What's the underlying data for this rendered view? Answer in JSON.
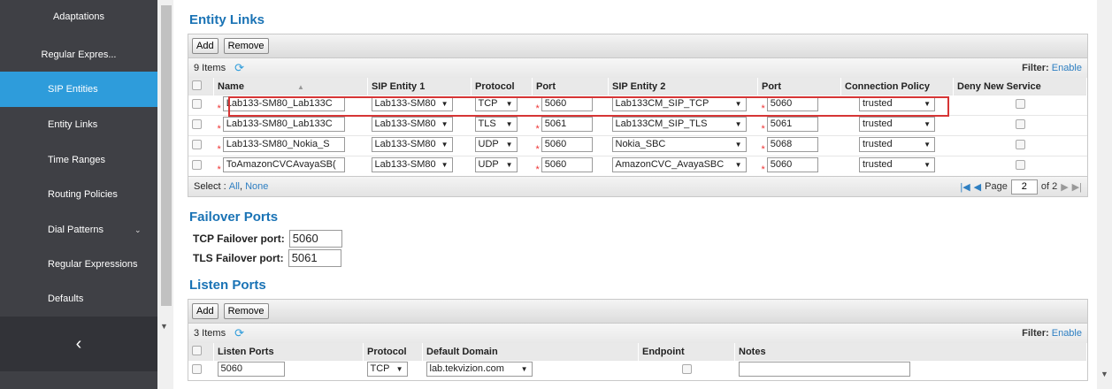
{
  "sidebar": {
    "items": [
      {
        "label": "Adaptations"
      },
      {
        "label": "Regular Expres..."
      },
      {
        "label": "SIP Entities"
      },
      {
        "label": "Entity Links"
      },
      {
        "label": "Time Ranges"
      },
      {
        "label": "Routing Policies"
      },
      {
        "label": "Dial Patterns"
      },
      {
        "label": "Regular Expressions"
      },
      {
        "label": "Defaults"
      }
    ],
    "collapse_icon": "chevron-left-icon",
    "collapse_glyph": "‹"
  },
  "entity_links": {
    "title": "Entity Links",
    "add_label": "Add",
    "remove_label": "Remove",
    "count_label": "9 Items",
    "filter_label": "Filter:",
    "filter_link": "Enable",
    "columns": [
      "Name",
      "SIP Entity 1",
      "Protocol",
      "Port",
      "SIP Entity 2",
      "Port",
      "Connection Policy",
      "Deny New Service"
    ],
    "rows": [
      {
        "name": "Lab133-SM80_Lab133C",
        "entity1": "Lab133-SM80",
        "protocol": "TCP",
        "port1": "5060",
        "entity2": "Lab133CM_SIP_TCP",
        "port2": "5060",
        "policy": "trusted"
      },
      {
        "name": "Lab133-SM80_Lab133C",
        "entity1": "Lab133-SM80",
        "protocol": "TLS",
        "port1": "5061",
        "entity2": "Lab133CM_SIP_TLS",
        "port2": "5061",
        "policy": "trusted"
      },
      {
        "name": "Lab133-SM80_Nokia_S",
        "entity1": "Lab133-SM80",
        "protocol": "UDP",
        "port1": "5060",
        "entity2": "Nokia_SBC",
        "port2": "5068",
        "policy": "trusted"
      },
      {
        "name": "ToAmazonCVCAvayaSB(",
        "entity1": "Lab133-SM80",
        "protocol": "UDP",
        "port1": "5060",
        "entity2": "AmazonCVC_AvayaSBC",
        "port2": "5060",
        "policy": "trusted"
      }
    ],
    "select_label": "Select :",
    "select_all": "All",
    "select_none": "None",
    "page_label": "Page",
    "page_value": "2",
    "page_of": "of 2"
  },
  "failover": {
    "title": "Failover Ports",
    "tcp_label": "TCP Failover port:",
    "tcp_value": "5060",
    "tls_label": "TLS Failover port:",
    "tls_value": "5061"
  },
  "listen_ports": {
    "title": "Listen Ports",
    "add_label": "Add",
    "remove_label": "Remove",
    "count_label": "3 Items",
    "filter_label": "Filter:",
    "filter_link": "Enable",
    "columns": [
      "Listen Ports",
      "Protocol",
      "Default Domain",
      "Endpoint",
      "Notes"
    ],
    "rows": [
      {
        "port": "5060",
        "protocol": "TCP",
        "domain": "lab.tekvizion.com",
        "notes": ""
      }
    ]
  },
  "colors": {
    "accent": "#2e9cdb",
    "sidebar": "#3f4045",
    "highlight": "#d63535",
    "title": "#1a73b5"
  }
}
